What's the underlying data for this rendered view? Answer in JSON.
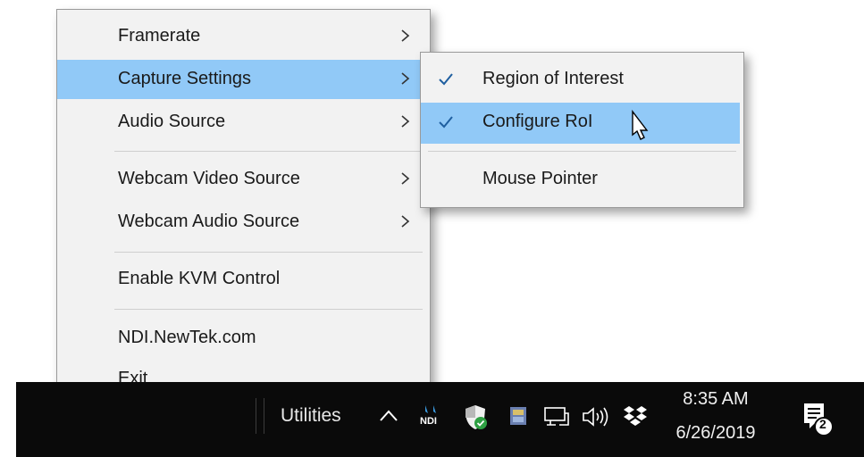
{
  "main_menu": {
    "items": [
      {
        "label": "Framerate",
        "has_submenu": true
      },
      {
        "label": "Capture Settings",
        "has_submenu": true,
        "highlighted": true
      },
      {
        "label": "Audio Source",
        "has_submenu": true
      },
      {
        "label": "Webcam Video Source",
        "has_submenu": true
      },
      {
        "label": "Webcam Audio Source",
        "has_submenu": true
      },
      {
        "label": "Enable KVM Control",
        "has_submenu": false
      },
      {
        "label": "NDI.NewTek.com",
        "has_submenu": false
      },
      {
        "label": "Exit",
        "has_submenu": false
      }
    ],
    "arrow_glyph": ">"
  },
  "sub_menu": {
    "items": [
      {
        "label": "Region of Interest",
        "checked": true
      },
      {
        "label": "Configure RoI",
        "checked": true,
        "highlighted": true
      },
      {
        "label": "Mouse Pointer",
        "checked": false
      }
    ]
  },
  "taskbar": {
    "toolbar_label": "Utilities",
    "time": "8:35 AM",
    "date": "6/26/2019",
    "ndi_icon_text": "NDI",
    "notification_count": "2",
    "tray_icons": [
      "chevron-up-icon",
      "ndi-icon",
      "shield-icon",
      "app-icon",
      "network-icon",
      "volume-icon",
      "dropbox-icon"
    ]
  },
  "colors": {
    "highlight": "#91c9f7",
    "menu_bg": "#f2f2f2",
    "taskbar_bg": "#0a0a0a",
    "check": "#1f5fa0"
  }
}
